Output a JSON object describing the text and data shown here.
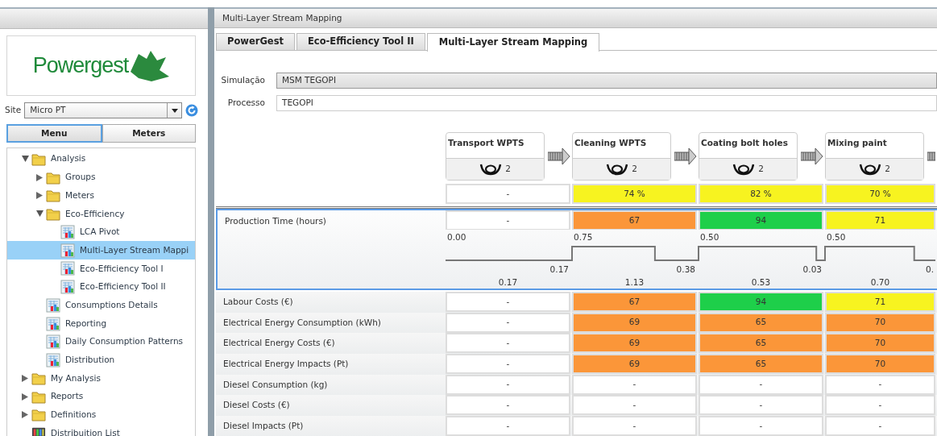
{
  "sidebar": {
    "logo_text": "Powergest",
    "site_label": "Site",
    "site_value": "Micro PT",
    "toggle": [
      {
        "label": "Menu",
        "selected": true
      },
      {
        "label": "Meters",
        "selected": false
      }
    ],
    "tree": [
      {
        "label": "Analysis",
        "kind": "folder",
        "expanded": true,
        "selected": false,
        "children": [
          {
            "label": "Groups",
            "kind": "folder",
            "expanded": false,
            "selected": false
          },
          {
            "label": "Meters",
            "kind": "folder",
            "expanded": false,
            "selected": false
          },
          {
            "label": "Eco-Efficiency",
            "kind": "folder",
            "expanded": true,
            "selected": false,
            "children": [
              {
                "label": "LCA Pivot",
                "kind": "report",
                "selected": false
              },
              {
                "label": "Multi-Layer Stream Mappi",
                "kind": "report",
                "selected": true
              },
              {
                "label": "Eco-Efficiency Tool I",
                "kind": "report",
                "selected": false
              },
              {
                "label": "Eco-Efficiency Tool II",
                "kind": "report",
                "selected": false
              }
            ]
          },
          {
            "label": "Consumptions Details",
            "kind": "report",
            "selected": false
          },
          {
            "label": "Reporting",
            "kind": "report",
            "selected": false
          },
          {
            "label": "Daily Consumption Patterns",
            "kind": "report",
            "selected": false
          },
          {
            "label": "Distribution",
            "kind": "report",
            "selected": false
          }
        ]
      },
      {
        "label": "My Analysis",
        "kind": "folder",
        "expanded": false,
        "selected": false
      },
      {
        "label": "Reports",
        "kind": "folder",
        "expanded": false,
        "selected": false
      },
      {
        "label": "Definitions",
        "kind": "folder",
        "expanded": false,
        "selected": false
      },
      {
        "label": "Distribuition List",
        "kind": "list",
        "selected": false
      }
    ]
  },
  "title": "Multi-Layer Stream Mapping",
  "tabs": [
    {
      "label": "PowerGest",
      "selected": false
    },
    {
      "label": "Eco-Efficiency Tool II",
      "selected": false
    },
    {
      "label": "Multi-Layer Stream Mapping",
      "selected": true
    }
  ],
  "form": [
    {
      "label": "Simulação",
      "value": "MSM TEGOPI",
      "kind": "select"
    },
    {
      "label": "Processo",
      "value": "TEGOPI",
      "kind": "text"
    }
  ],
  "processes": [
    {
      "name": "Transport WPTS",
      "operators": "2",
      "efficiency": {
        "text": "-",
        "color": "#ffffff"
      }
    },
    {
      "name": "Cleaning WPTS",
      "operators": "2",
      "efficiency": {
        "text": "74 %",
        "color": "#f7f320"
      }
    },
    {
      "name": "Coating bolt holes",
      "operators": "2",
      "efficiency": {
        "text": "82 %",
        "color": "#f7f320"
      }
    },
    {
      "name": "Mixing paint",
      "operators": "2",
      "efficiency": {
        "text": "70 %",
        "color": "#f7f320"
      }
    }
  ],
  "production_time": {
    "label": "Production Time (hours)",
    "cells": [
      {
        "text": "-",
        "color": "#ffffff"
      },
      {
        "text": "67",
        "color": "#fb9639"
      },
      {
        "text": "94",
        "color": "#1ecf4a"
      },
      {
        "text": "71",
        "color": "#f7f320"
      }
    ],
    "timeline": [
      {
        "value_added": "0.00",
        "waiting": "0.17",
        "total": "0.17"
      },
      {
        "value_added": "0.75",
        "waiting": "0.38",
        "total": "1.13"
      },
      {
        "value_added": "0.50",
        "waiting": "0.03",
        "total": "0.53"
      },
      {
        "value_added": "0.50",
        "waiting": "0.",
        "total": "0.70"
      }
    ]
  },
  "metrics": [
    {
      "label": "Labour Costs (€)",
      "cells": [
        {
          "text": "-",
          "color": "#ffffff"
        },
        {
          "text": "67",
          "color": "#fb9639"
        },
        {
          "text": "94",
          "color": "#1ecf4a"
        },
        {
          "text": "71",
          "color": "#f7f320"
        }
      ]
    },
    {
      "label": "Electrical Energy Consumption (kWh)",
      "cells": [
        {
          "text": "-",
          "color": "#ffffff"
        },
        {
          "text": "69",
          "color": "#fb9639"
        },
        {
          "text": "65",
          "color": "#fb9639"
        },
        {
          "text": "70",
          "color": "#fb9639"
        }
      ]
    },
    {
      "label": "Electrical Energy Costs (€)",
      "cells": [
        {
          "text": "-",
          "color": "#ffffff"
        },
        {
          "text": "69",
          "color": "#fb9639"
        },
        {
          "text": "65",
          "color": "#fb9639"
        },
        {
          "text": "70",
          "color": "#fb9639"
        }
      ]
    },
    {
      "label": "Electrical Energy Impacts (Pt)",
      "cells": [
        {
          "text": "-",
          "color": "#ffffff"
        },
        {
          "text": "69",
          "color": "#fb9639"
        },
        {
          "text": "65",
          "color": "#fb9639"
        },
        {
          "text": "70",
          "color": "#fb9639"
        }
      ]
    },
    {
      "label": "Diesel Consumption (kg)",
      "cells": [
        {
          "text": "-",
          "color": "#ffffff"
        },
        {
          "text": "-",
          "color": "#ffffff"
        },
        {
          "text": "-",
          "color": "#ffffff"
        },
        {
          "text": "-",
          "color": "#ffffff"
        }
      ]
    },
    {
      "label": "Diesel Costs (€)",
      "cells": [
        {
          "text": "-",
          "color": "#ffffff"
        },
        {
          "text": "-",
          "color": "#ffffff"
        },
        {
          "text": "-",
          "color": "#ffffff"
        },
        {
          "text": "-",
          "color": "#ffffff"
        }
      ]
    },
    {
      "label": "Diesel Impacts (Pt)",
      "cells": [
        {
          "text": "-",
          "color": "#ffffff"
        },
        {
          "text": "-",
          "color": "#ffffff"
        },
        {
          "text": "-",
          "color": "#ffffff"
        },
        {
          "text": "-",
          "color": "#ffffff"
        }
      ]
    }
  ]
}
